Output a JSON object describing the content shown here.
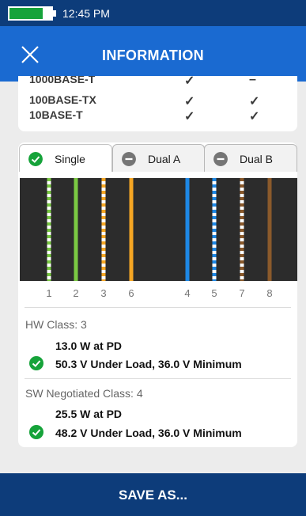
{
  "status_bar": {
    "time": "12:45 PM",
    "battery_level": 0.8,
    "battery_color": "#16a33a"
  },
  "header": {
    "title": "INFORMATION",
    "close_icon": "close-icon"
  },
  "link_speeds": [
    {
      "name": "1000BASE-T",
      "col1": "✓",
      "col2": "–"
    },
    {
      "name": "100BASE-TX",
      "col1": "✓",
      "col2": "✓"
    },
    {
      "name": "10BASE-T",
      "col1": "✓",
      "col2": "✓"
    }
  ],
  "tabs": [
    {
      "label": "Single",
      "state": "pass",
      "active": true
    },
    {
      "label": "Dual A",
      "state": "inactive",
      "active": false
    },
    {
      "label": "Dual B",
      "state": "inactive",
      "active": false
    }
  ],
  "wires": [
    {
      "pin": "1",
      "color": "#7ac943",
      "striped": true
    },
    {
      "pin": "2",
      "color": "#7ac943",
      "striped": false
    },
    {
      "pin": "3",
      "color": "#f5a623",
      "striped": true
    },
    {
      "pin": "6",
      "color": "#f5a623",
      "striped": false
    },
    {
      "pin": "4",
      "color": "#1e88e5",
      "striped": false
    },
    {
      "pin": "5",
      "color": "#1e88e5",
      "striped": true
    },
    {
      "pin": "7",
      "color": "#8b5a2b",
      "striped": true
    },
    {
      "pin": "8",
      "color": "#8b5a2b",
      "striped": false
    }
  ],
  "hw_class": {
    "label": "HW Class: 3",
    "power": "13.0 W at PD",
    "voltage": "50.3 V Under Load, 36.0 V Minimum"
  },
  "sw_class": {
    "label": "SW Negotiated Class: 4",
    "power": "25.5 W at PD",
    "voltage": "48.2 V Under Load, 36.0 V Minimum"
  },
  "footer": {
    "save_label": "SAVE AS..."
  },
  "colors": {
    "primary": "#1a6ad1",
    "dark": "#0d3c7a",
    "pass": "#16a33a"
  }
}
